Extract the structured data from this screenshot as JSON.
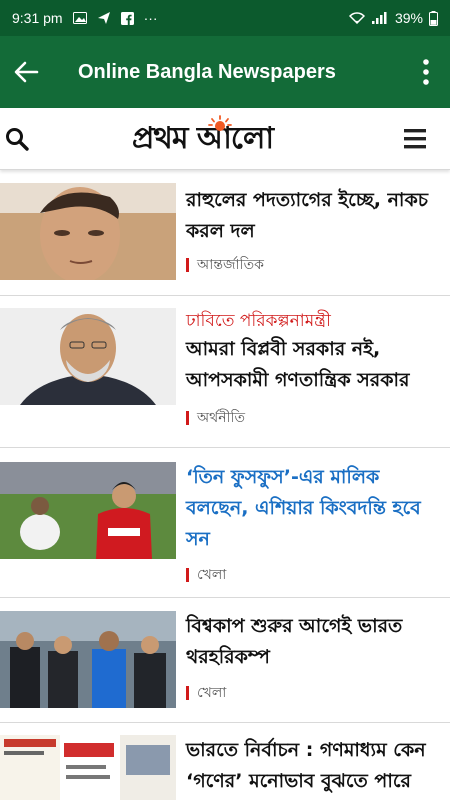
{
  "status_bar": {
    "time": "9:31 pm",
    "dots": "···",
    "battery": "39%",
    "icons": [
      "image-icon",
      "navigation-icon",
      "facebook-icon",
      "wifi-icon",
      "signal-icon",
      "battery-icon"
    ]
  },
  "app_bar": {
    "title": "Online Bangla Newspapers",
    "color": "#136b38",
    "status_color": "#0c5a2d"
  },
  "site_header": {
    "logo": "প্রথম আলো",
    "icons": [
      "search-icon",
      "menu-icon"
    ]
  },
  "articles": [
    {
      "kicker": "",
      "headline": "রাহুলের পদত্যাগের ইচ্ছে, নাকচ করল দল",
      "category": "আন্তর্জাতিক"
    },
    {
      "kicker": "ঢাবিতে পরিকল্পনামন্ত্রী",
      "headline": "আমরা বিপ্লবী সরকার নই, আপসকামী গণতান্ত্রিক সরকার",
      "category": "অর্থনীতি"
    },
    {
      "kicker": "",
      "headline": "‘তিন ফুসফুস’-এর মালিক বলছেন, এশিয়ার কিংবদন্তি হবে সন",
      "category": "খেলা"
    },
    {
      "kicker": "",
      "headline": "বিশ্বকাপ শুরুর আগেই ভারত থরহরিকম্প",
      "category": "খেলা"
    },
    {
      "kicker": "",
      "headline": "ভারতে নির্বাচন : গণমাধ্যম কেন ‘গণের’ মনোভাব বুঝতে পারে",
      "category": ""
    }
  ]
}
